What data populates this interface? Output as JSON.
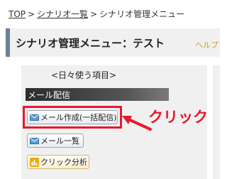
{
  "breadcrumb": {
    "items": [
      "TOP",
      "シナリオ一覧",
      "シナリオ管理メニュー"
    ],
    "separator": ">"
  },
  "header": {
    "title": "シナリオ管理メニュー：テスト",
    "help_label": "ヘルプ"
  },
  "panel": {
    "heading": "<日々使う項目>",
    "section_label": "メール配信",
    "buttons": {
      "compose": "メール作成(一括配信)",
      "list": "メール一覧",
      "click_analysis": "クリック分析"
    }
  },
  "annotation": {
    "label": "クリック",
    "color": "#e8192c"
  },
  "colors": {
    "accent_bar": "#6b7f96",
    "panel_bg": "#f0f0f0"
  }
}
